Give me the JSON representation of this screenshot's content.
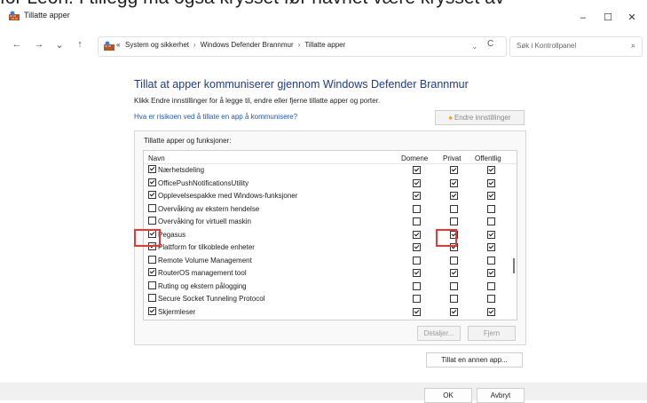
{
  "caption_text": "for Leon. I tillegg må også krysset før navnet være krysset av",
  "window": {
    "title": "Tillatte apper",
    "minimize": "–",
    "maximize": "☐",
    "close": "✕"
  },
  "nav": {
    "back": "←",
    "forward": "→",
    "recent": "⌄",
    "up": "↑"
  },
  "address": {
    "prefix": "«",
    "crumbs": [
      "System og sikkerhet",
      "Windows Defender Brannmur",
      "Tillatte apper"
    ],
    "separator": "›",
    "dropdown": "⌄",
    "refresh": "C"
  },
  "search": {
    "placeholder": "Søk i Kontrollpanel",
    "icon": "⌕"
  },
  "main": {
    "title": "Tillat at apper kommuniserer gjennom Windows Defender Brannmur",
    "subtitle": "Klikk Endre innstillinger for å legge til, endre eller fjerne tillatte apper og porter.",
    "risk_link": "Hva er risikoen ved å tillate en app å kommunisere?",
    "change_settings": "Endre innstillinger",
    "group_label": "Tillatte apper og funksjoner:"
  },
  "columns": {
    "name": "Navn",
    "domain": "Domene",
    "private": "Privat",
    "public": "Offentlig"
  },
  "apps": [
    {
      "name": "Nærhetsdeling",
      "enabled": true,
      "domain": true,
      "private": true,
      "public": true
    },
    {
      "name": "OfficePushNotificationsUtility",
      "enabled": true,
      "domain": true,
      "private": true,
      "public": true
    },
    {
      "name": "Opplevelsespakke med Windows-funksjoner",
      "enabled": true,
      "domain": true,
      "private": true,
      "public": true
    },
    {
      "name": "Overvåking av ekstern hendelse",
      "enabled": false,
      "domain": false,
      "private": false,
      "public": false
    },
    {
      "name": "Overvåking for virtuell maskin",
      "enabled": false,
      "domain": false,
      "private": false,
      "public": false
    },
    {
      "name": "Pegasus",
      "enabled": true,
      "domain": true,
      "private": true,
      "public": true
    },
    {
      "name": "Plattform for tilkoblede enheter",
      "enabled": true,
      "domain": true,
      "private": true,
      "public": true
    },
    {
      "name": "Remote Volume Management",
      "enabled": false,
      "domain": false,
      "private": false,
      "public": false
    },
    {
      "name": "RouterOS management tool",
      "enabled": true,
      "domain": true,
      "private": true,
      "public": true
    },
    {
      "name": "Ruting og ekstern pålogging",
      "enabled": false,
      "domain": false,
      "private": false,
      "public": false
    },
    {
      "name": "Secure Socket Tunneling Protocol",
      "enabled": false,
      "domain": false,
      "private": false,
      "public": false
    },
    {
      "name": "Skjermleser",
      "enabled": true,
      "domain": true,
      "private": true,
      "public": true
    }
  ],
  "buttons": {
    "details": "Detaljer...",
    "remove": "Fjern",
    "allow_other": "Tillat en annen app...",
    "ok": "OK",
    "cancel": "Avbryt"
  },
  "highlight_color": "#e53935"
}
